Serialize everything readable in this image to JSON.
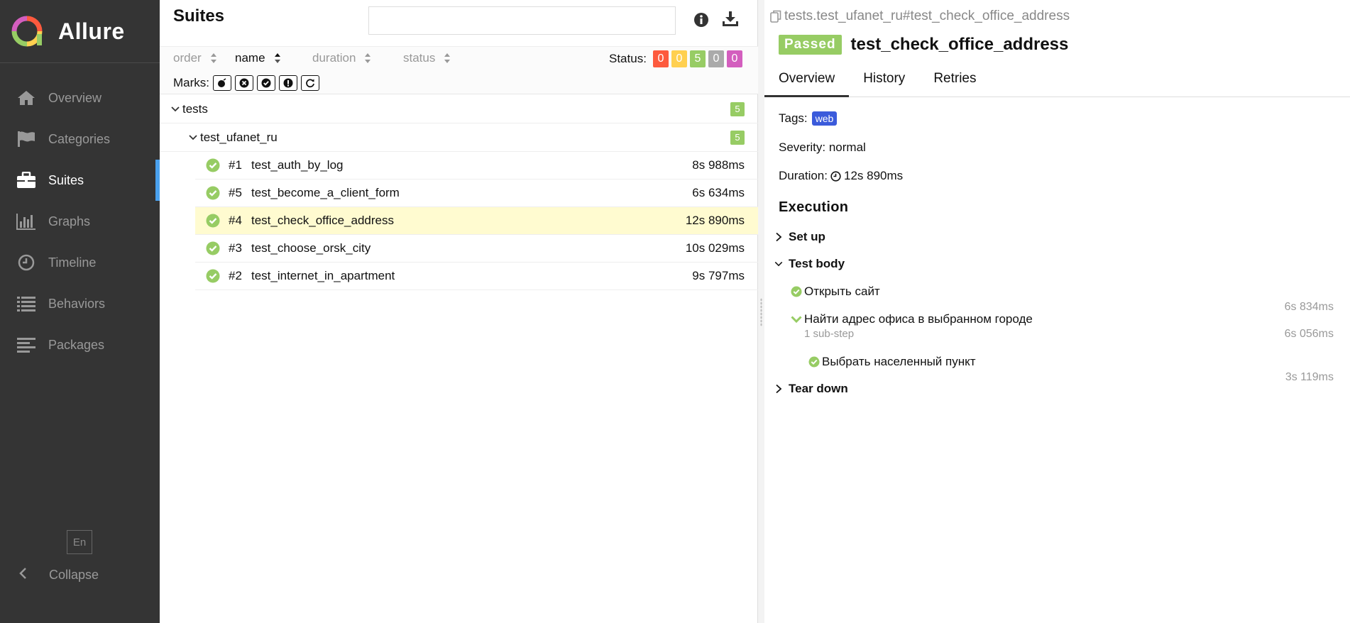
{
  "sidebar": {
    "brand": "Allure",
    "items": [
      {
        "label": "Overview",
        "icon": "home-icon"
      },
      {
        "label": "Categories",
        "icon": "flag-icon"
      },
      {
        "label": "Suites",
        "icon": "briefcase-icon"
      },
      {
        "label": "Graphs",
        "icon": "bar-chart-icon"
      },
      {
        "label": "Timeline",
        "icon": "clock-icon"
      },
      {
        "label": "Behaviors",
        "icon": "list-icon"
      },
      {
        "label": "Packages",
        "icon": "align-left-icon"
      }
    ],
    "active": "Suites",
    "language": "En",
    "collapse": "Collapse"
  },
  "suites": {
    "title": "Suites",
    "search_value": "",
    "sort": {
      "order": "order",
      "name": "name",
      "duration": "duration",
      "status": "status"
    },
    "status_label": "Status:",
    "status_counts": [
      {
        "value": "0",
        "color": "#fd5a3e"
      },
      {
        "value": "0",
        "color": "#ffd050"
      },
      {
        "value": "5",
        "color": "#97cc64"
      },
      {
        "value": "0",
        "color": "#aaaaaa"
      },
      {
        "value": "0",
        "color": "#d35ebe"
      }
    ],
    "marks_label": "Marks:",
    "marks": [
      "new-failed-icon",
      "new-broken-icon",
      "new-passed-icon",
      "flaky-icon",
      "retries-icon"
    ],
    "tree": {
      "root": {
        "label": "tests",
        "count": "5"
      },
      "child": {
        "label": "test_ufanet_ru",
        "count": "5"
      },
      "cases": [
        {
          "num": "#1",
          "name": "test_auth_by_log",
          "duration": "8s 988ms"
        },
        {
          "num": "#5",
          "name": "test_become_a_client_form",
          "duration": "6s 634ms"
        },
        {
          "num": "#4",
          "name": "test_check_office_address",
          "duration": "12s 890ms"
        },
        {
          "num": "#3",
          "name": "test_choose_orsk_city",
          "duration": "10s 029ms"
        },
        {
          "num": "#2",
          "name": "test_internet_in_apartment",
          "duration": "9s 797ms"
        }
      ]
    }
  },
  "detail": {
    "breadcrumb": "tests.test_ufanet_ru#test_check_office_address",
    "status": "Passed",
    "title": "test_check_office_address",
    "tabs": [
      "Overview",
      "History",
      "Retries"
    ],
    "tags_label": "Tags:",
    "tag": "web",
    "severity": "Severity: normal",
    "duration_label": "Duration:",
    "duration": "12s 890ms",
    "execution": "Execution",
    "setup": "Set up",
    "test_body": "Test body",
    "steps": [
      {
        "name": "Открыть сайт",
        "duration": "6s 834ms"
      },
      {
        "name": "Найти адрес офиса в выбранном городе",
        "duration": "6s 056ms",
        "note": "1 sub-step"
      },
      {
        "name": "Выбрать населенный пункт",
        "duration": "3s 119ms"
      }
    ],
    "teardown": "Tear down"
  }
}
